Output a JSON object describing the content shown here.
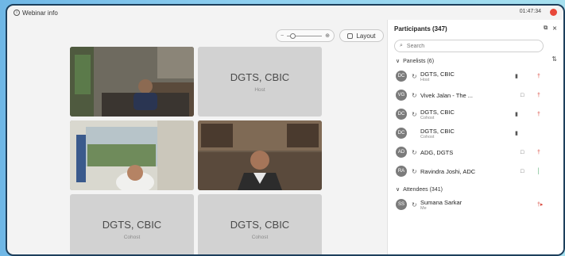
{
  "window": {
    "title": "Webinar info",
    "timer": "01:47:34",
    "colors": {
      "record": "#e8483a",
      "frame": "#1d3f5c"
    }
  },
  "toolbar": {
    "layout_label": "Layout"
  },
  "tiles": [
    {
      "name": "",
      "role": "",
      "video": true
    },
    {
      "name": "DGTS, CBIC",
      "role": "Host",
      "video": false
    },
    {
      "name": "",
      "role": "",
      "video": true
    },
    {
      "name": "",
      "role": "",
      "video": true
    },
    {
      "name": "DGTS, CBIC",
      "role": "Cohost",
      "video": false
    },
    {
      "name": "DGTS, CBIC",
      "role": "Cohost",
      "video": false
    }
  ],
  "panel": {
    "title": "Participants (347)",
    "search_placeholder": "Search",
    "panelists_label": "Panelists (6)",
    "attendees_label": "Attendees (341)",
    "panelists": [
      {
        "initials": "DC",
        "name": "DGTS, CBIC",
        "role": "Host",
        "icon": "video-off",
        "mic": "muted"
      },
      {
        "initials": "VG",
        "name": "Vivek Jalan - The ...",
        "role": "",
        "icon": "video",
        "mic": "muted"
      },
      {
        "initials": "DC",
        "name": "DGTS, CBIC",
        "role": "Cohost",
        "icon": "video-off",
        "mic": "muted"
      },
      {
        "initials": "DC",
        "name": "DGTS, CBIC",
        "role": "Cohost",
        "icon": "video-off",
        "mic": ""
      },
      {
        "initials": "AD",
        "name": "ADG, DGTS",
        "role": "",
        "icon": "video",
        "mic": "muted"
      },
      {
        "initials": "RA",
        "name": "Ravindra Joshi, ADC",
        "role": "",
        "icon": "video",
        "mic": "active"
      }
    ],
    "attendees": [
      {
        "initials": "SS",
        "name": "Sumana Sarkar",
        "role": "Me",
        "icon": "",
        "mic": "muted"
      }
    ]
  }
}
